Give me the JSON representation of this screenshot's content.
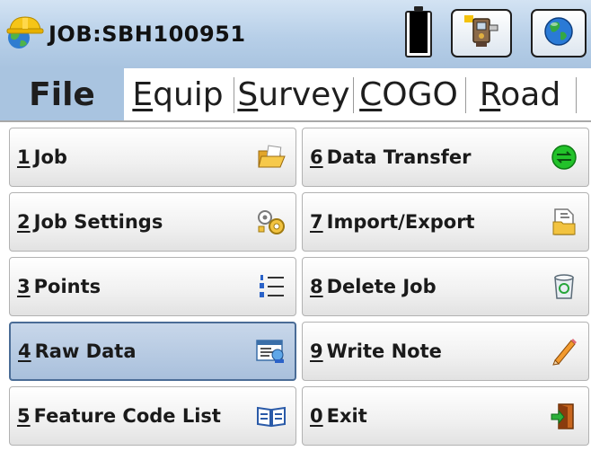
{
  "titlebar": {
    "job_title": "JOB:SBH100951",
    "app_icon": "surveyor-hardhat-icon",
    "battery": {
      "icon": "battery-icon",
      "level_fraction": 0.95
    },
    "buttons": [
      {
        "icon": "instrument-icon"
      },
      {
        "icon": "globe-icon"
      }
    ]
  },
  "tabs": [
    {
      "label": "File",
      "mnemonic": "",
      "rest": "File",
      "active": true
    },
    {
      "label": "Equip",
      "mnemonic": "E",
      "rest": "quip",
      "active": false
    },
    {
      "label": "Survey",
      "mnemonic": "S",
      "rest": "urvey",
      "active": false
    },
    {
      "label": "COGO",
      "mnemonic": "C",
      "rest": "OGO",
      "active": false
    },
    {
      "label": "Road",
      "mnemonic": "R",
      "rest": "oad",
      "active": false
    }
  ],
  "menu": {
    "left": [
      {
        "num": "1",
        "label": "Job",
        "icon": "folder-open-icon",
        "selected": false
      },
      {
        "num": "2",
        "label": "Job Settings",
        "icon": "settings-gears-icon",
        "selected": false
      },
      {
        "num": "3",
        "label": "Points",
        "icon": "numbered-list-icon",
        "selected": false
      },
      {
        "num": "4",
        "label": "Raw Data",
        "icon": "raw-data-icon",
        "selected": true
      },
      {
        "num": "5",
        "label": "Feature Code List",
        "icon": "open-book-icon",
        "selected": false
      }
    ],
    "right": [
      {
        "num": "6",
        "label": "Data Transfer",
        "icon": "transfer-circle-icon",
        "selected": false
      },
      {
        "num": "7",
        "label": "Import/Export",
        "icon": "import-export-icon",
        "selected": false
      },
      {
        "num": "8",
        "label": "Delete Job",
        "icon": "recycle-bin-icon",
        "selected": false
      },
      {
        "num": "9",
        "label": "Write Note",
        "icon": "pencil-icon",
        "selected": false
      },
      {
        "num": "0",
        "label": "Exit",
        "icon": "exit-door-icon",
        "selected": false
      }
    ]
  },
  "colors": {
    "titlebar": "#b7cfe8",
    "active_tab": "#a9c4e0",
    "selected_item": "#a9c0dc",
    "transfer_green": "#22c22a"
  }
}
